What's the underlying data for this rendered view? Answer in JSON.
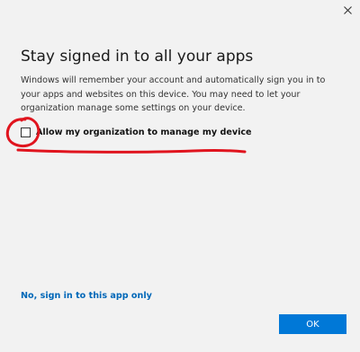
{
  "dialog": {
    "title": "Stay signed in to all your apps",
    "description": "Windows will remember your account and automatically sign you in to your apps and websites on this device. You may need to let your organization manage some settings on your device.",
    "checkbox_label": "Allow my organization to manage my device",
    "checkbox_checked": false,
    "alt_link": "No, sign in to this app only",
    "ok_label": "OK"
  },
  "colors": {
    "accent": "#0078d7",
    "link": "#0067b8",
    "annotation": "#e0141e"
  },
  "icons": {
    "close": "close-icon"
  }
}
